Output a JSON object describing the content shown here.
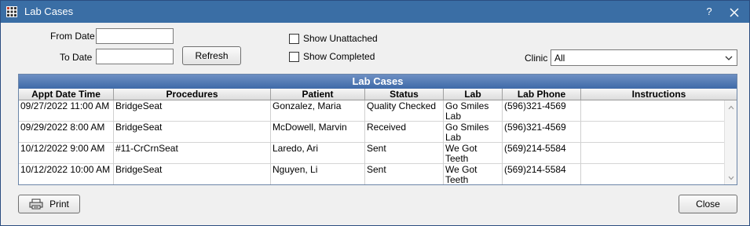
{
  "window": {
    "title": "Lab Cases",
    "help_label": "?"
  },
  "filters": {
    "from_date_label": "From Date",
    "to_date_label": "To Date",
    "from_date_value": "",
    "to_date_value": "",
    "refresh_label": "Refresh",
    "show_unattached_label": "Show Unattached",
    "show_completed_label": "Show Completed",
    "clinic_label": "Clinic",
    "clinic_value": "All"
  },
  "grid": {
    "title": "Lab Cases",
    "columns": [
      "Appt Date Time",
      "Procedures",
      "Patient",
      "Status",
      "Lab",
      "Lab Phone",
      "Instructions"
    ],
    "rows": [
      [
        "09/27/2022 11:00 AM",
        "BridgeSeat",
        "Gonzalez, Maria",
        "Quality Checked",
        "Go Smiles\nLab",
        "(596)321-4569",
        ""
      ],
      [
        "09/29/2022 8:00 AM",
        "BridgeSeat",
        "McDowell, Marvin",
        "Received",
        "Go Smiles\nLab",
        "(596)321-4569",
        ""
      ],
      [
        "10/12/2022 9:00 AM",
        "#11-CrCrnSeat",
        "Laredo, Ari",
        "Sent",
        "We Got\nTeeth",
        "(569)214-5584",
        ""
      ],
      [
        "10/12/2022 10:00 AM",
        "BridgeSeat",
        "Nguyen, Li",
        "Sent",
        "We Got\nTeeth",
        "(569)214-5584",
        ""
      ]
    ]
  },
  "footer": {
    "print_label": "Print",
    "close_label": "Close"
  },
  "colors": {
    "titlebar": "#3a6ea5",
    "grid_title": "#4a74b0"
  },
  "icons": [
    "app-grid-icon",
    "close-icon",
    "printer-icon",
    "chevron-down-icon",
    "scroll-up-icon",
    "scroll-down-icon"
  ]
}
